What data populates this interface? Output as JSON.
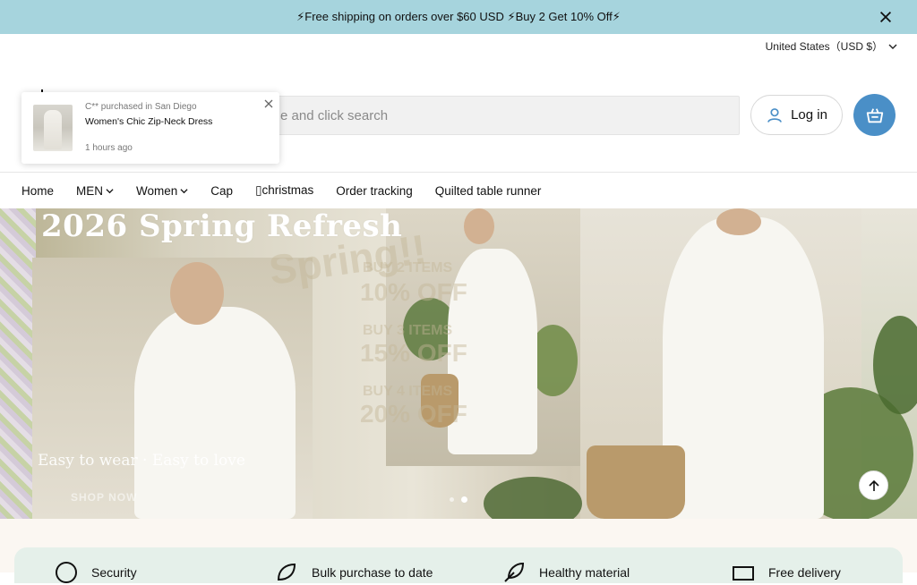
{
  "announcement": {
    "text": "⚡Free shipping on orders over $60 USD ⚡Buy 2 Get 10% Off⚡"
  },
  "locale": {
    "label": "United States（USD $）"
  },
  "search": {
    "placeholder": "e and click search"
  },
  "header": {
    "login_label": "Log in"
  },
  "popup": {
    "who": "C** purchased in San Diego",
    "product": "Women's Chic Zip-Neck Dress",
    "time": "1 hours ago"
  },
  "nav": {
    "items": [
      {
        "label": "Home"
      },
      {
        "label": "MEN"
      },
      {
        "label": "Women"
      },
      {
        "label": "Cap"
      },
      {
        "label": "▯christmas"
      },
      {
        "label": "Order tracking"
      },
      {
        "label": "Quilted table runner"
      }
    ]
  },
  "hero": {
    "headline": "2026 Spring Refresh",
    "tagline": "Easy to wear · Easy to love",
    "shop_now": "SHOP NOW",
    "overlay_words": [
      "Spring!!",
      "BUY 2 ITEMS",
      "10% OFF",
      "BUY 3 ITEMS",
      "15% OFF",
      "BUY 4 ITEMS",
      "20% OFF"
    ],
    "slides": 2,
    "active_slide": 2
  },
  "features": {
    "items": [
      {
        "label": "Security",
        "icon": "shield-icon"
      },
      {
        "label": "Bulk purchase to date",
        "icon": "leaf-icon"
      },
      {
        "label": "Healthy material",
        "icon": "feather-icon"
      },
      {
        "label": "Free delivery",
        "icon": "truck-icon"
      }
    ]
  },
  "colors": {
    "announcement_bg": "#a6d4dd",
    "cart_accent": "#4a8fc7",
    "login_icon": "#4a8fc7",
    "features_bg": "#e5f0ea"
  }
}
